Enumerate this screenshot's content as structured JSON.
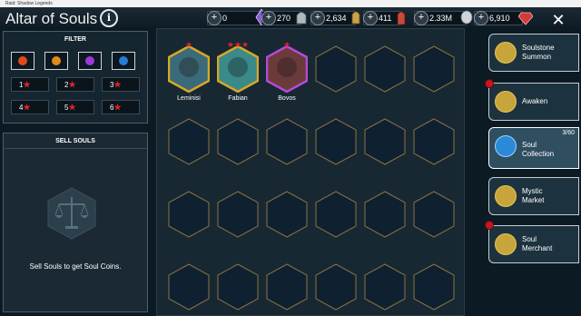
{
  "window": {
    "title": "Raid: Shadow Legends"
  },
  "header": {
    "title": "Altar of Souls",
    "info_glyph": "i",
    "close_glyph": "✕"
  },
  "resources": [
    {
      "name": "energy",
      "value": "0",
      "color": "#8a5bd8"
    },
    {
      "name": "arena-tokens",
      "value": "270",
      "color": "#b0b7bd"
    },
    {
      "name": "auto-battle",
      "value": "2,634",
      "color": "#c9a34a"
    },
    {
      "name": "shards",
      "value": "411",
      "color": "#c94a3a"
    },
    {
      "name": "silver",
      "value": "2.33M",
      "color": "#cfd4d8"
    },
    {
      "name": "gems",
      "value": "6,910",
      "color": "#d33a3a"
    }
  ],
  "filter": {
    "title": "FILTER",
    "chips": [
      {
        "icon": "shield-icon",
        "color": "#e04a1a"
      },
      {
        "icon": "magic-icon",
        "color": "#e08a1a"
      },
      {
        "icon": "spirit-icon",
        "color": "#9b3ad8"
      },
      {
        "icon": "force-icon",
        "color": "#2a7ad8"
      }
    ],
    "stars": [
      "1",
      "2",
      "3",
      "4",
      "5",
      "6"
    ],
    "star_glyph": "★"
  },
  "sell": {
    "title": "SELL SOULS",
    "text": "Sell Souls to get Soul Coins."
  },
  "souls": [
    {
      "name": "Leminisi",
      "stars": 1,
      "frame": "#d8a726",
      "color": "#3b6b7a"
    },
    {
      "name": "Fabian",
      "stars": 3,
      "frame": "#d8a726",
      "color": "#3a8a8a"
    },
    {
      "name": "Bovos",
      "stars": 1,
      "frame": "#b64ad8",
      "color": "#6b3a3a"
    }
  ],
  "sidebar": [
    {
      "label": "Soulstone Summon",
      "selected": false,
      "badge": false
    },
    {
      "label": "Awaken",
      "selected": false,
      "badge": true
    },
    {
      "label": "Soul Collection",
      "selected": true,
      "badge": false,
      "count": "3/60"
    },
    {
      "label": "Mystic Market",
      "selected": false,
      "badge": false
    },
    {
      "label": "Soul Merchant",
      "selected": false,
      "badge": true
    }
  ]
}
